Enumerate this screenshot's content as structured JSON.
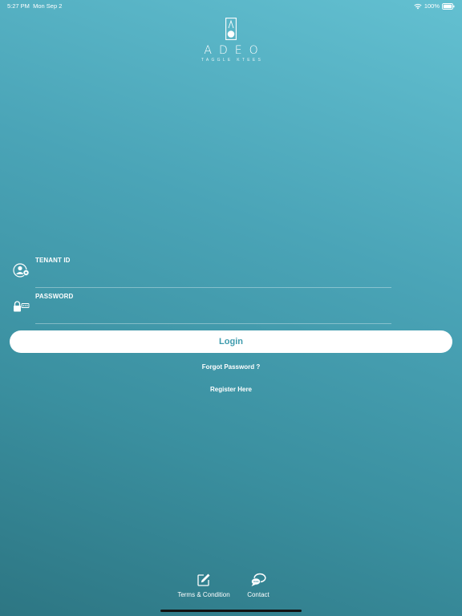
{
  "status_bar": {
    "time": "5:27 PM",
    "date": "Mon Sep 2",
    "battery": "100%",
    "icons": [
      "wifi-icon",
      "battery-icon"
    ]
  },
  "brand": {
    "name": "ADEO",
    "tagline": "TAGGLE KTEES"
  },
  "form": {
    "tenant_label": "TENANT ID",
    "tenant_value": "",
    "tenant_icon": "tenant-user-icon",
    "password_label": "PASSWORD",
    "password_value": "",
    "password_icon": "lock-key-icon"
  },
  "actions": {
    "login_label": "Login",
    "forgot_label": "Forgot Password ?",
    "register_label": "Register Here"
  },
  "footer": {
    "terms_label": "Terms & Condition",
    "terms_icon": "edit-document-icon",
    "contact_label": "Contact",
    "contact_icon": "contact-chat-icon"
  },
  "colors": {
    "gradient_top": "#63c0d1",
    "gradient_bottom": "#2d7683",
    "button_bg": "#ffffff",
    "button_text": "#3e9bad"
  }
}
